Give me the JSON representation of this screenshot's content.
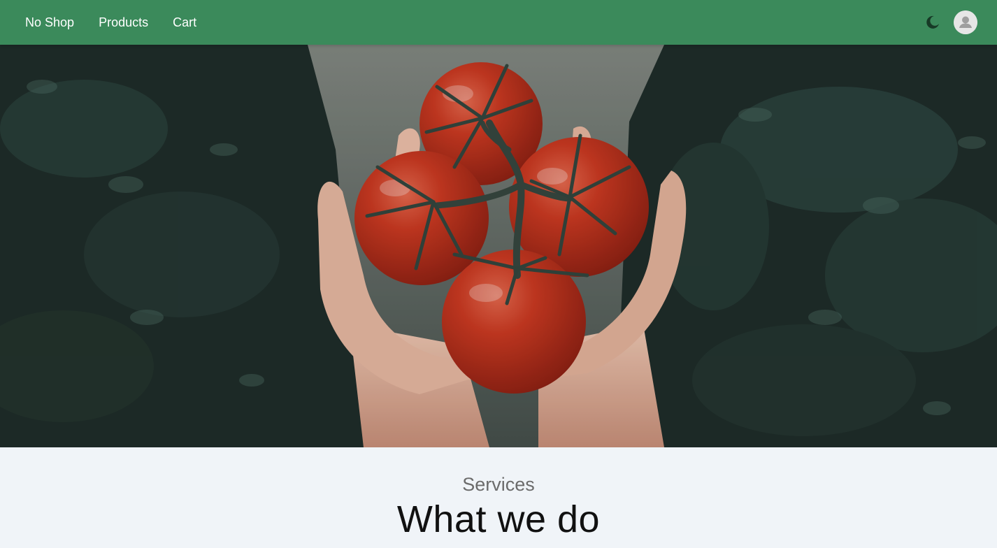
{
  "nav": {
    "links": [
      "No Shop",
      "Products",
      "Cart"
    ],
    "theme_toggle_icon": "moon-icon",
    "avatar_icon": "user-avatar-icon"
  },
  "hero": {
    "image_subject": "hands-holding-tomatoes-image"
  },
  "services": {
    "eyebrow": "Services",
    "title": "What we do"
  },
  "colors": {
    "navbar": "#3b8a5b",
    "page_background": "#f0f4f8",
    "tomato": "#c8321f"
  }
}
